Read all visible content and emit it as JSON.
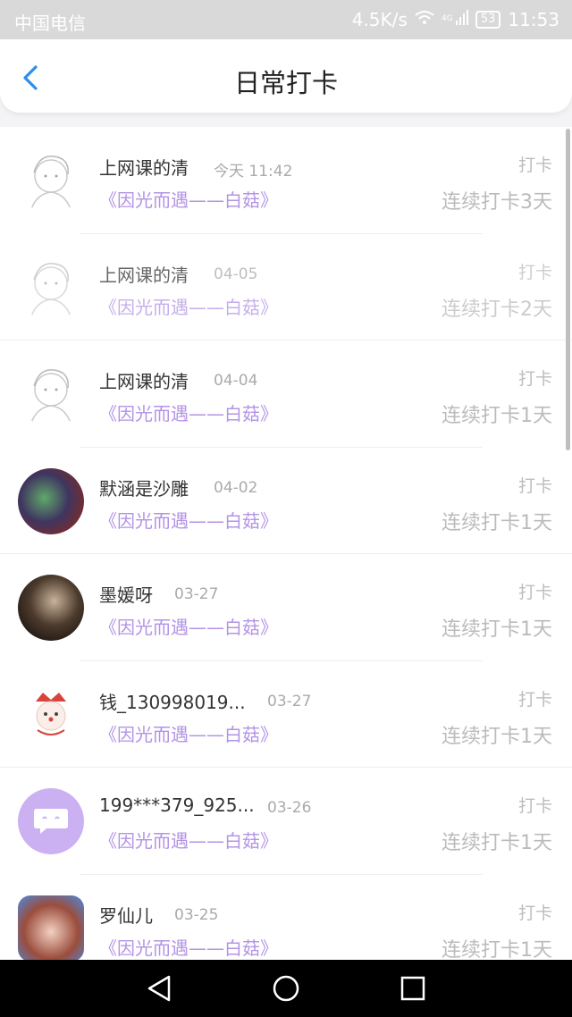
{
  "status_bar": {
    "carrier": "中国电信",
    "speed": "4.5K/s",
    "signal_text": "4G",
    "battery": "53",
    "time": "11:53"
  },
  "header": {
    "title": "日常打卡"
  },
  "entries": [
    {
      "name": "上网课的清",
      "date": "今天 11:42",
      "book": "《因光而遇——白菇》",
      "checkin_label": "打卡",
      "streak": "连续打卡3天",
      "avatar": "sketch-avatar"
    },
    {
      "name": "上网课的清",
      "date": "04-05",
      "book": "《因光而遇——白菇》",
      "checkin_label": "打卡",
      "streak": "连续打卡2天",
      "avatar": "sketch-avatar"
    },
    {
      "name": "上网课的清",
      "date": "04-04",
      "book": "《因光而遇——白菇》",
      "checkin_label": "打卡",
      "streak": "连续打卡1天",
      "avatar": "sketch-avatar"
    },
    {
      "name": "默涵是沙雕",
      "date": "04-02",
      "book": "《因光而遇——白菇》",
      "checkin_label": "打卡",
      "streak": "连续打卡1天",
      "avatar": "anime-avatar"
    },
    {
      "name": "墨媛呀",
      "date": "03-27",
      "book": "《因光而遇——白菇》",
      "checkin_label": "打卡",
      "streak": "连续打卡1天",
      "avatar": "photo-avatar"
    },
    {
      "name": "钱_130998019...",
      "date": "03-27",
      "book": "《因光而遇——白菇》",
      "checkin_label": "打卡",
      "streak": "连续打卡1天",
      "avatar": "clown-avatar"
    },
    {
      "name": "199***379_925...",
      "date": "03-26",
      "book": "《因光而遇——白菇》",
      "checkin_label": "打卡",
      "streak": "连续打卡1天",
      "avatar": "default-chat-avatar"
    },
    {
      "name": "罗仙儿",
      "date": "03-25",
      "book": "《因光而遇——白菇》",
      "checkin_label": "打卡",
      "streak": "连续打卡1天",
      "avatar": "anime-avatar"
    }
  ],
  "nav_bar": {
    "icons": [
      "back-triangle-icon",
      "home-circle-icon",
      "recents-square-icon"
    ]
  },
  "colors": {
    "accent_blue": "#2b8ef0",
    "book_purple": "#b493e6",
    "avatar_default": "#cbb1f2"
  }
}
